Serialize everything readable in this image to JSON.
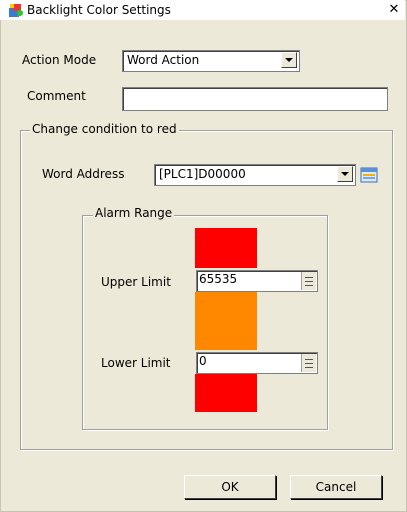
{
  "window": {
    "title": "Backlight Color Settings",
    "close_glyph": "✕"
  },
  "action_mode": {
    "label": "Action Mode",
    "value": "Word Action"
  },
  "comment": {
    "label": "Comment",
    "value": ""
  },
  "change_group": {
    "legend": "Change condition to red",
    "word_address_label": "Word Address",
    "word_address_value": "[PLC1]D00000"
  },
  "alarm_range": {
    "legend": "Alarm Range",
    "upper_label": "Upper Limit",
    "upper_value": "65535",
    "lower_label": "Lower Limit",
    "lower_value": "0",
    "colors": {
      "alarm": "#ff0000",
      "normal": "#ff8800"
    }
  },
  "buttons": {
    "ok": "OK",
    "cancel": "Cancel"
  },
  "icons": {
    "app": "palette-icon",
    "address_browse": "address-input-icon",
    "dropdown": "chevron-down-icon"
  }
}
